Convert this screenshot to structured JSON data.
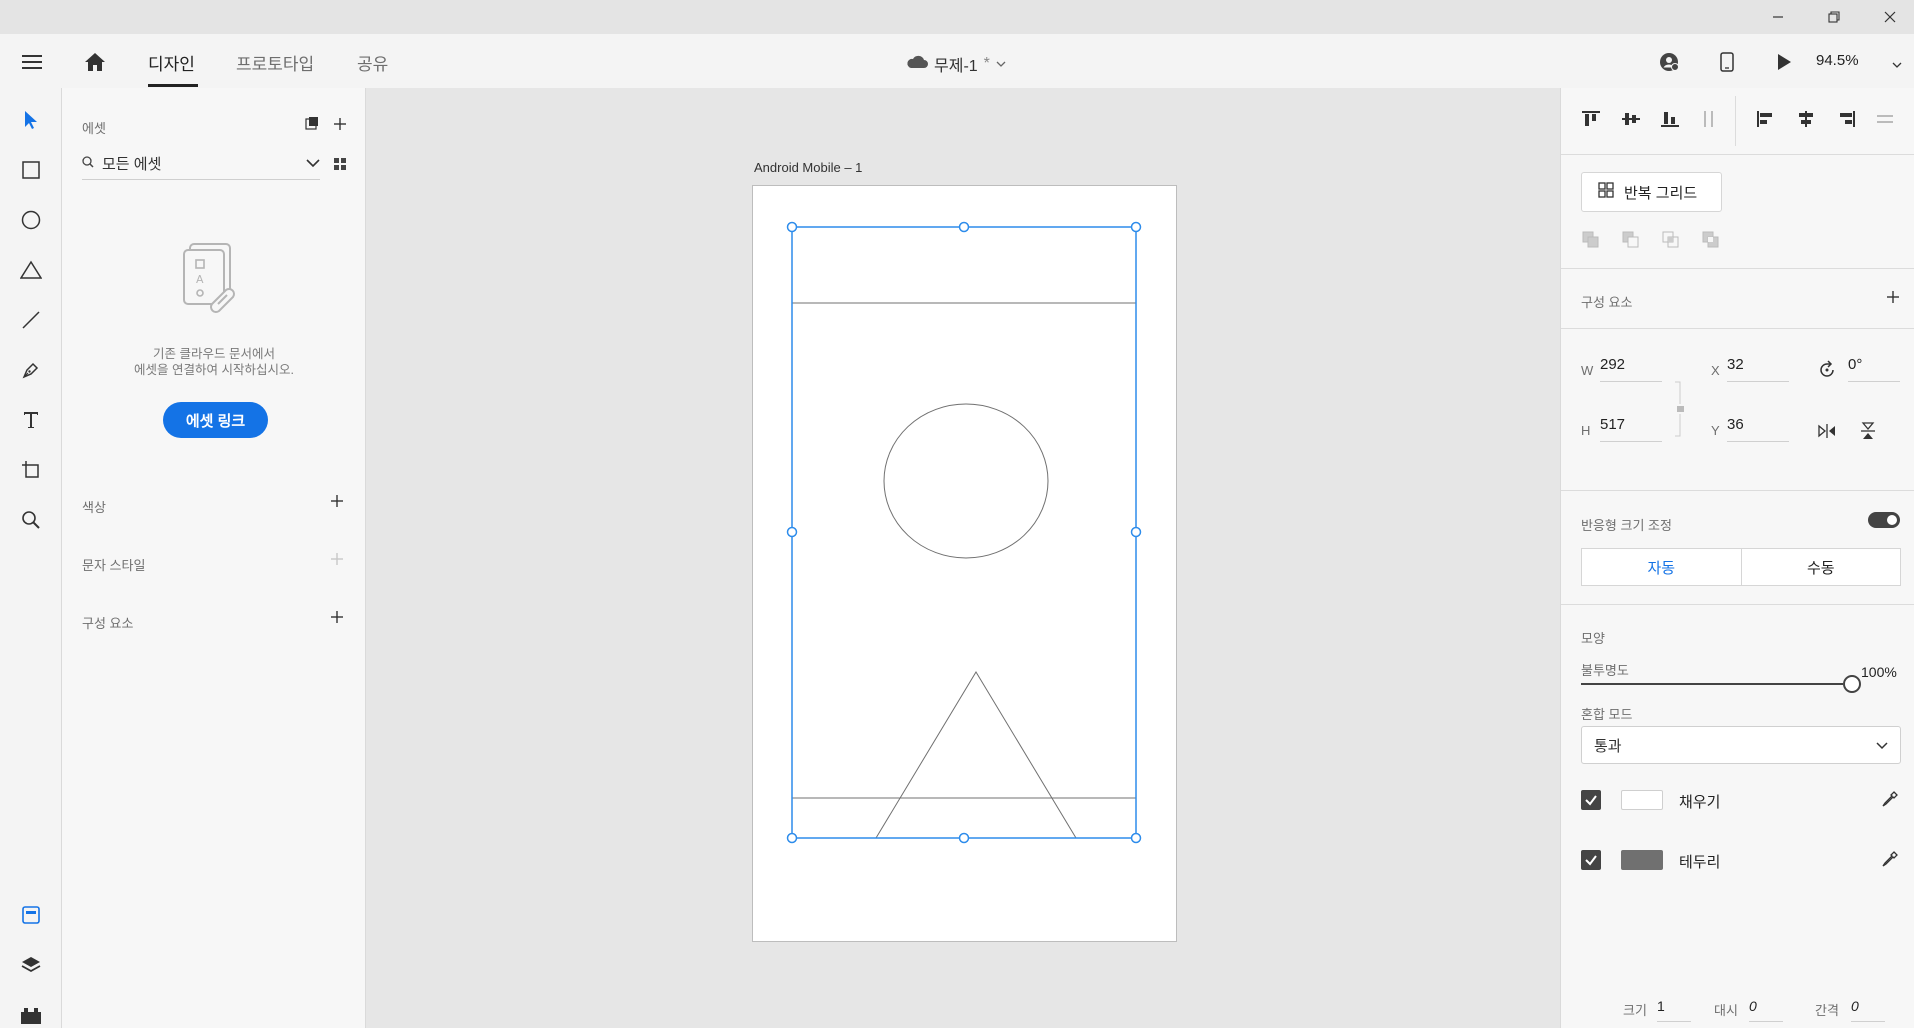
{
  "window": {
    "minimize_icon": "minimize-icon",
    "restore_icon": "restore-icon",
    "close_icon": "close-icon"
  },
  "appbar": {
    "tabs": [
      {
        "label": "디자인",
        "active": true
      },
      {
        "label": "프로토타입",
        "active": false
      },
      {
        "label": "공유",
        "active": false
      }
    ],
    "document_title": "무제-1",
    "unsaved_marker": "*",
    "zoom": "94.5%"
  },
  "assets": {
    "header": "에셋",
    "search_value": "모든 에셋",
    "empty_line1": "기존 클라우드 문서에서",
    "empty_line2": "에셋을 연결하여 시작하십시오.",
    "link_button": "에셋 링크",
    "sections": {
      "colors": "색상",
      "char_styles": "문자 스타일",
      "components": "구성 요소"
    }
  },
  "canvas": {
    "artboard_name": "Android Mobile – 1",
    "selection_color": "#2d8ceb"
  },
  "inspector": {
    "repeat_grid": "반복 그리드",
    "components_title": "구성 요소",
    "w_label": "W",
    "w_value": "292",
    "h_label": "H",
    "h_value": "517",
    "x_label": "X",
    "x_value": "32",
    "y_label": "Y",
    "y_value": "36",
    "rotation": "0°",
    "responsive_title": "반응형 크기 조정",
    "responsive_on": true,
    "seg_auto": "자동",
    "seg_manual": "수동",
    "appearance_title": "모양",
    "opacity_label": "불투명도",
    "opacity_value": "100%",
    "opacity_fraction": 1.0,
    "blend_label": "혼합 모드",
    "blend_value": "통과",
    "fill_label": "채우기",
    "fill_checked": true,
    "fill_color": "#ffffff",
    "border_label": "테두리",
    "border_checked": true,
    "border_color": "#707070",
    "size_label": "크기",
    "size_value": "1",
    "dash_label": "대시",
    "dash_value": "0",
    "gap_label": "간격",
    "gap_value": "0"
  }
}
